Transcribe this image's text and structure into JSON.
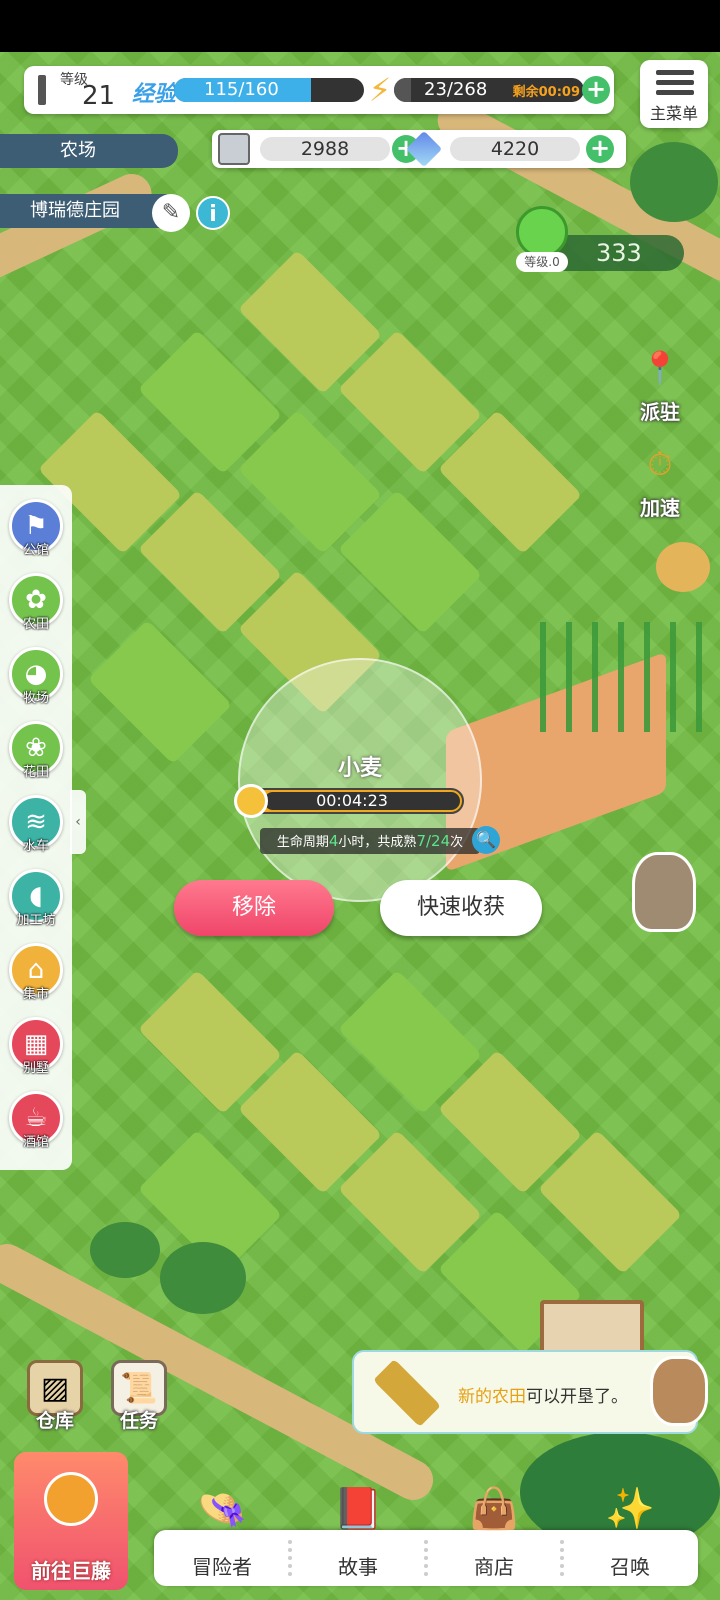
{
  "hud": {
    "level_label": "等级",
    "level_value": "21",
    "exp_label": "经验",
    "exp_text": "115/160",
    "exp_progress": 0.72,
    "energy_text": "23/268",
    "energy_progress": 0.09,
    "energy_timer": "剩余00:09",
    "menu_label": "主菜单",
    "coins": "2988",
    "gems": "4220",
    "area_name": "农场",
    "estate_name": "博瑞德庄园",
    "popularity_value": "333",
    "popularity_level": "等级.0",
    "colors": {
      "exp": "#3db0ea",
      "accent": "#45c06a",
      "remove": "#f0456a"
    }
  },
  "side_tools": [
    {
      "label": "派驻",
      "icon": "map-pin-icon"
    },
    {
      "label": "加速",
      "icon": "stopwatch-icon"
    }
  ],
  "left_menu": [
    {
      "label": "公馆",
      "icon": "mansion-icon",
      "color": "#5b7fd6"
    },
    {
      "label": "农田",
      "icon": "wheat-icon",
      "color": "#73c34d"
    },
    {
      "label": "牧场",
      "icon": "cow-icon",
      "color": "#73c34d"
    },
    {
      "label": "花田",
      "icon": "flower-icon",
      "color": "#73c34d"
    },
    {
      "label": "水车",
      "icon": "water-icon",
      "color": "#3db3a6"
    },
    {
      "label": "加工坊",
      "icon": "bread-icon",
      "color": "#3db3a6"
    },
    {
      "label": "集市",
      "icon": "market-icon",
      "color": "#f0b23a"
    },
    {
      "label": "别墅",
      "icon": "villa-icon",
      "color": "#e5485b"
    },
    {
      "label": "酒馆",
      "icon": "tavern-icon",
      "color": "#e5485b"
    }
  ],
  "crop_popup": {
    "name": "小麦",
    "timer": "00:04:23",
    "info_prefix": "生命周期",
    "info_hours": "4",
    "info_middle": "小时，共成熟",
    "info_count": "7/24",
    "info_suffix": "次",
    "remove_label": "移除",
    "harvest_label": "快速收获"
  },
  "notice": {
    "highlight": "新的农田",
    "text": "可以开垦了。"
  },
  "quick_buttons": [
    {
      "label": "仓库",
      "icon": "crate-icon"
    },
    {
      "label": "任务",
      "icon": "scroll-icon"
    }
  ],
  "giant_button_label": "前往巨藤",
  "bottom_nav": [
    {
      "label": "冒险者",
      "icon": "adventurer-icon"
    },
    {
      "label": "故事",
      "icon": "book-icon"
    },
    {
      "label": "商店",
      "icon": "shop-icon"
    },
    {
      "label": "召唤",
      "icon": "summon-icon"
    }
  ]
}
